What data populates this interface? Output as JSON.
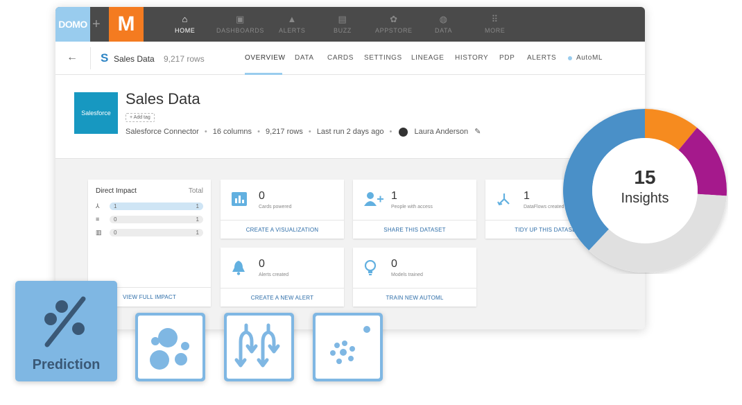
{
  "topbar": {
    "domo_logo": "DOMO",
    "plus": "+",
    "m_logo": "M",
    "nav": [
      {
        "label": "HOME",
        "icon": "home-icon",
        "glyph": "⌂"
      },
      {
        "label": "DASHBOARDS",
        "icon": "dashboards-icon",
        "glyph": "▣"
      },
      {
        "label": "ALERTS",
        "icon": "bell-icon",
        "glyph": "▲"
      },
      {
        "label": "BUZZ",
        "icon": "chat-icon",
        "glyph": "▤"
      },
      {
        "label": "APPSTORE",
        "icon": "appstore-icon",
        "glyph": "✿"
      },
      {
        "label": "DATA",
        "icon": "database-icon",
        "glyph": "◍"
      },
      {
        "label": "MORE",
        "icon": "grid-icon",
        "glyph": "⠿"
      }
    ]
  },
  "subbar": {
    "back": "←",
    "dataset_icon": "S",
    "dataset_name": "Sales Data",
    "row_count": "9,217 rows",
    "tabs": [
      "OVERVIEW",
      "DATA",
      "CARDS",
      "SETTINGS",
      "LINEAGE",
      "HISTORY",
      "PDP",
      "ALERTS",
      "AutoML"
    ],
    "active_tab": "OVERVIEW"
  },
  "header": {
    "logo_text": "Salesforce",
    "title": "Sales Data",
    "add_tag": "+ Add tag",
    "connector": "Salesforce Connector",
    "columns": "16 columns",
    "rows": "9,217 rows",
    "last_run": "Last run 2 days ago",
    "owner": "Laura Anderson",
    "sep": "•"
  },
  "impact": {
    "title": "Direct Impact",
    "total_label": "Total",
    "rows": [
      {
        "icon": "dataflow-icon",
        "glyph": "⅄",
        "value": "1",
        "total": "1"
      },
      {
        "icon": "database-icon",
        "glyph": "≡",
        "value": "0",
        "total": "1"
      },
      {
        "icon": "card-icon",
        "glyph": "▥",
        "value": "0",
        "total": "1"
      }
    ],
    "link": "VIEW FULL IMPACT"
  },
  "stats": [
    {
      "icon": "chart-icon",
      "glyph": "▥",
      "value": "0",
      "label": "Cards powered",
      "action": "CREATE A VISUALIZATION"
    },
    {
      "icon": "add-user-icon",
      "glyph": "👤+",
      "value": "1",
      "label": "People with access",
      "action": "SHARE THIS DATASET"
    },
    {
      "icon": "dataflow-icon",
      "glyph": "⤵",
      "value": "1",
      "label": "DataFlows created",
      "action": "TIDY UP THIS DATASET"
    },
    {
      "icon": "bell-icon",
      "glyph": "🔔",
      "value": "0",
      "label": "Alerts created",
      "action": "CREATE A NEW ALERT"
    },
    {
      "icon": "lightbulb-icon",
      "glyph": "💡",
      "value": "0",
      "label": "Models trained",
      "action": "TRAIN NEW AUTOML"
    }
  ],
  "insights": {
    "count": "15",
    "label": "Insights",
    "segments": [
      {
        "color": "#f68b1f",
        "fraction": 0.11
      },
      {
        "color": "#a5198c",
        "fraction": 0.15
      },
      {
        "color": "#e0e0e0",
        "fraction": 0.36
      },
      {
        "color": "#4a90c8",
        "fraction": 0.38
      }
    ]
  },
  "tiles": {
    "prediction_label": "Prediction"
  },
  "colors": {
    "accent": "#99ccee",
    "link": "#2d6da8",
    "tile": "#7fb7e3"
  }
}
